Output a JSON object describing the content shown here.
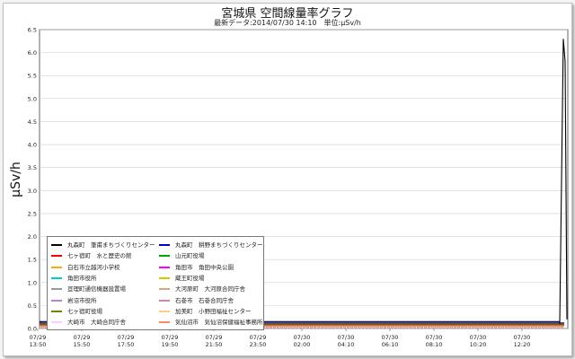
{
  "title": "宮城県 空間線量率グラフ",
  "subtitle": "最新データ:2014/07/30 14:10　単位:μSv/h",
  "chart_data": {
    "type": "line",
    "title": "宮城県 空間線量率グラフ",
    "subtitle": "最新データ:2014/07/30 14:10　単位:μSv/h",
    "ylabel": "μSv/h",
    "xlabel": "",
    "ylim": [
      0,
      6.5
    ],
    "yticks": [
      "0.0",
      "0.5",
      "1.0",
      "1.5",
      "2.0",
      "2.5",
      "3.0",
      "3.5",
      "4.0",
      "4.5",
      "5.0",
      "5.5",
      "6.0",
      "6.5"
    ],
    "xtick_labels": [
      {
        "date": "07/29",
        "time": "13:50"
      },
      {
        "date": "07/29",
        "time": "15:50"
      },
      {
        "date": "07/29",
        "time": "17:50"
      },
      {
        "date": "07/29",
        "time": "19:50"
      },
      {
        "date": "07/29",
        "time": "21:50"
      },
      {
        "date": "07/29",
        "time": "23:50"
      },
      {
        "date": "07/30",
        "time": "02:00"
      },
      {
        "date": "07/30",
        "time": "04:10"
      },
      {
        "date": "07/30",
        "time": "06:10"
      },
      {
        "date": "07/30",
        "time": "08:10"
      },
      {
        "date": "07/30",
        "time": "10:20"
      },
      {
        "date": "07/30",
        "time": "12:20"
      }
    ],
    "grid": true,
    "legend_position": "bottom-left",
    "series": [
      {
        "name": "丸森町　筆甫まちづくりセンター",
        "color": "#000000",
        "baseline": 0.15,
        "spike": [
          0.1,
          6.3,
          5.8,
          0.2
        ]
      },
      {
        "name": "丸森町　耕野まちづくりセンター",
        "color": "#0000cc",
        "baseline": 0.12
      },
      {
        "name": "七ヶ宿町　水と歴史の館",
        "color": "#ff0000",
        "baseline": 0.08
      },
      {
        "name": "山元町役場",
        "color": "#00aa00",
        "baseline": 0.1
      },
      {
        "name": "白石市立越河小学校",
        "color": "#ffaa00",
        "baseline": 0.09
      },
      {
        "name": "角田市　角田中央公園",
        "color": "#ff00ff",
        "baseline": 0.1
      },
      {
        "name": "角田市役所",
        "color": "#00cccc",
        "baseline": 0.09
      },
      {
        "name": "蔵王町役場",
        "color": "#cccc00",
        "baseline": 0.07
      },
      {
        "name": "亘理町通信機器設置場",
        "color": "#999999",
        "baseline": 0.07
      },
      {
        "name": "大河原町　大河原合同庁舎",
        "color": "#ccaa88",
        "baseline": 0.06
      },
      {
        "name": "岩沼市役所",
        "color": "#aa88cc",
        "baseline": 0.06
      },
      {
        "name": "石巻市　石巻合同庁舎",
        "color": "#cc88aa",
        "baseline": 0.05
      },
      {
        "name": "七ヶ宿町役場",
        "color": "#668800",
        "baseline": 0.06
      },
      {
        "name": "加美町　小野田福祉センター",
        "color": "#ffcc88",
        "baseline": 0.05
      },
      {
        "name": "大崎市　大崎合同庁舎",
        "color": "#ffccff",
        "baseline": 0.05
      },
      {
        "name": "気仙沼市　気仙沼保健福祉事務所",
        "color": "#ff8866",
        "baseline": 0.05
      }
    ]
  }
}
